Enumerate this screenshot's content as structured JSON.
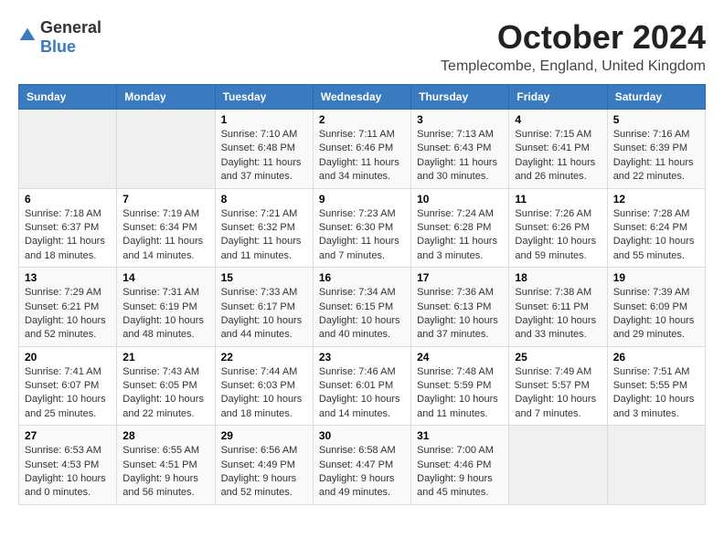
{
  "logo": {
    "general": "General",
    "blue": "Blue"
  },
  "header": {
    "month": "October 2024",
    "location": "Templecombe, England, United Kingdom"
  },
  "weekdays": [
    "Sunday",
    "Monday",
    "Tuesday",
    "Wednesday",
    "Thursday",
    "Friday",
    "Saturday"
  ],
  "weeks": [
    [
      {
        "day": "",
        "sunrise": "",
        "sunset": "",
        "daylight": ""
      },
      {
        "day": "",
        "sunrise": "",
        "sunset": "",
        "daylight": ""
      },
      {
        "day": "1",
        "sunrise": "Sunrise: 7:10 AM",
        "sunset": "Sunset: 6:48 PM",
        "daylight": "Daylight: 11 hours and 37 minutes."
      },
      {
        "day": "2",
        "sunrise": "Sunrise: 7:11 AM",
        "sunset": "Sunset: 6:46 PM",
        "daylight": "Daylight: 11 hours and 34 minutes."
      },
      {
        "day": "3",
        "sunrise": "Sunrise: 7:13 AM",
        "sunset": "Sunset: 6:43 PM",
        "daylight": "Daylight: 11 hours and 30 minutes."
      },
      {
        "day": "4",
        "sunrise": "Sunrise: 7:15 AM",
        "sunset": "Sunset: 6:41 PM",
        "daylight": "Daylight: 11 hours and 26 minutes."
      },
      {
        "day": "5",
        "sunrise": "Sunrise: 7:16 AM",
        "sunset": "Sunset: 6:39 PM",
        "daylight": "Daylight: 11 hours and 22 minutes."
      }
    ],
    [
      {
        "day": "6",
        "sunrise": "Sunrise: 7:18 AM",
        "sunset": "Sunset: 6:37 PM",
        "daylight": "Daylight: 11 hours and 18 minutes."
      },
      {
        "day": "7",
        "sunrise": "Sunrise: 7:19 AM",
        "sunset": "Sunset: 6:34 PM",
        "daylight": "Daylight: 11 hours and 14 minutes."
      },
      {
        "day": "8",
        "sunrise": "Sunrise: 7:21 AM",
        "sunset": "Sunset: 6:32 PM",
        "daylight": "Daylight: 11 hours and 11 minutes."
      },
      {
        "day": "9",
        "sunrise": "Sunrise: 7:23 AM",
        "sunset": "Sunset: 6:30 PM",
        "daylight": "Daylight: 11 hours and 7 minutes."
      },
      {
        "day": "10",
        "sunrise": "Sunrise: 7:24 AM",
        "sunset": "Sunset: 6:28 PM",
        "daylight": "Daylight: 11 hours and 3 minutes."
      },
      {
        "day": "11",
        "sunrise": "Sunrise: 7:26 AM",
        "sunset": "Sunset: 6:26 PM",
        "daylight": "Daylight: 10 hours and 59 minutes."
      },
      {
        "day": "12",
        "sunrise": "Sunrise: 7:28 AM",
        "sunset": "Sunset: 6:24 PM",
        "daylight": "Daylight: 10 hours and 55 minutes."
      }
    ],
    [
      {
        "day": "13",
        "sunrise": "Sunrise: 7:29 AM",
        "sunset": "Sunset: 6:21 PM",
        "daylight": "Daylight: 10 hours and 52 minutes."
      },
      {
        "day": "14",
        "sunrise": "Sunrise: 7:31 AM",
        "sunset": "Sunset: 6:19 PM",
        "daylight": "Daylight: 10 hours and 48 minutes."
      },
      {
        "day": "15",
        "sunrise": "Sunrise: 7:33 AM",
        "sunset": "Sunset: 6:17 PM",
        "daylight": "Daylight: 10 hours and 44 minutes."
      },
      {
        "day": "16",
        "sunrise": "Sunrise: 7:34 AM",
        "sunset": "Sunset: 6:15 PM",
        "daylight": "Daylight: 10 hours and 40 minutes."
      },
      {
        "day": "17",
        "sunrise": "Sunrise: 7:36 AM",
        "sunset": "Sunset: 6:13 PM",
        "daylight": "Daylight: 10 hours and 37 minutes."
      },
      {
        "day": "18",
        "sunrise": "Sunrise: 7:38 AM",
        "sunset": "Sunset: 6:11 PM",
        "daylight": "Daylight: 10 hours and 33 minutes."
      },
      {
        "day": "19",
        "sunrise": "Sunrise: 7:39 AM",
        "sunset": "Sunset: 6:09 PM",
        "daylight": "Daylight: 10 hours and 29 minutes."
      }
    ],
    [
      {
        "day": "20",
        "sunrise": "Sunrise: 7:41 AM",
        "sunset": "Sunset: 6:07 PM",
        "daylight": "Daylight: 10 hours and 25 minutes."
      },
      {
        "day": "21",
        "sunrise": "Sunrise: 7:43 AM",
        "sunset": "Sunset: 6:05 PM",
        "daylight": "Daylight: 10 hours and 22 minutes."
      },
      {
        "day": "22",
        "sunrise": "Sunrise: 7:44 AM",
        "sunset": "Sunset: 6:03 PM",
        "daylight": "Daylight: 10 hours and 18 minutes."
      },
      {
        "day": "23",
        "sunrise": "Sunrise: 7:46 AM",
        "sunset": "Sunset: 6:01 PM",
        "daylight": "Daylight: 10 hours and 14 minutes."
      },
      {
        "day": "24",
        "sunrise": "Sunrise: 7:48 AM",
        "sunset": "Sunset: 5:59 PM",
        "daylight": "Daylight: 10 hours and 11 minutes."
      },
      {
        "day": "25",
        "sunrise": "Sunrise: 7:49 AM",
        "sunset": "Sunset: 5:57 PM",
        "daylight": "Daylight: 10 hours and 7 minutes."
      },
      {
        "day": "26",
        "sunrise": "Sunrise: 7:51 AM",
        "sunset": "Sunset: 5:55 PM",
        "daylight": "Daylight: 10 hours and 3 minutes."
      }
    ],
    [
      {
        "day": "27",
        "sunrise": "Sunrise: 6:53 AM",
        "sunset": "Sunset: 4:53 PM",
        "daylight": "Daylight: 10 hours and 0 minutes."
      },
      {
        "day": "28",
        "sunrise": "Sunrise: 6:55 AM",
        "sunset": "Sunset: 4:51 PM",
        "daylight": "Daylight: 9 hours and 56 minutes."
      },
      {
        "day": "29",
        "sunrise": "Sunrise: 6:56 AM",
        "sunset": "Sunset: 4:49 PM",
        "daylight": "Daylight: 9 hours and 52 minutes."
      },
      {
        "day": "30",
        "sunrise": "Sunrise: 6:58 AM",
        "sunset": "Sunset: 4:47 PM",
        "daylight": "Daylight: 9 hours and 49 minutes."
      },
      {
        "day": "31",
        "sunrise": "Sunrise: 7:00 AM",
        "sunset": "Sunset: 4:46 PM",
        "daylight": "Daylight: 9 hours and 45 minutes."
      },
      {
        "day": "",
        "sunrise": "",
        "sunset": "",
        "daylight": ""
      },
      {
        "day": "",
        "sunrise": "",
        "sunset": "",
        "daylight": ""
      }
    ]
  ]
}
